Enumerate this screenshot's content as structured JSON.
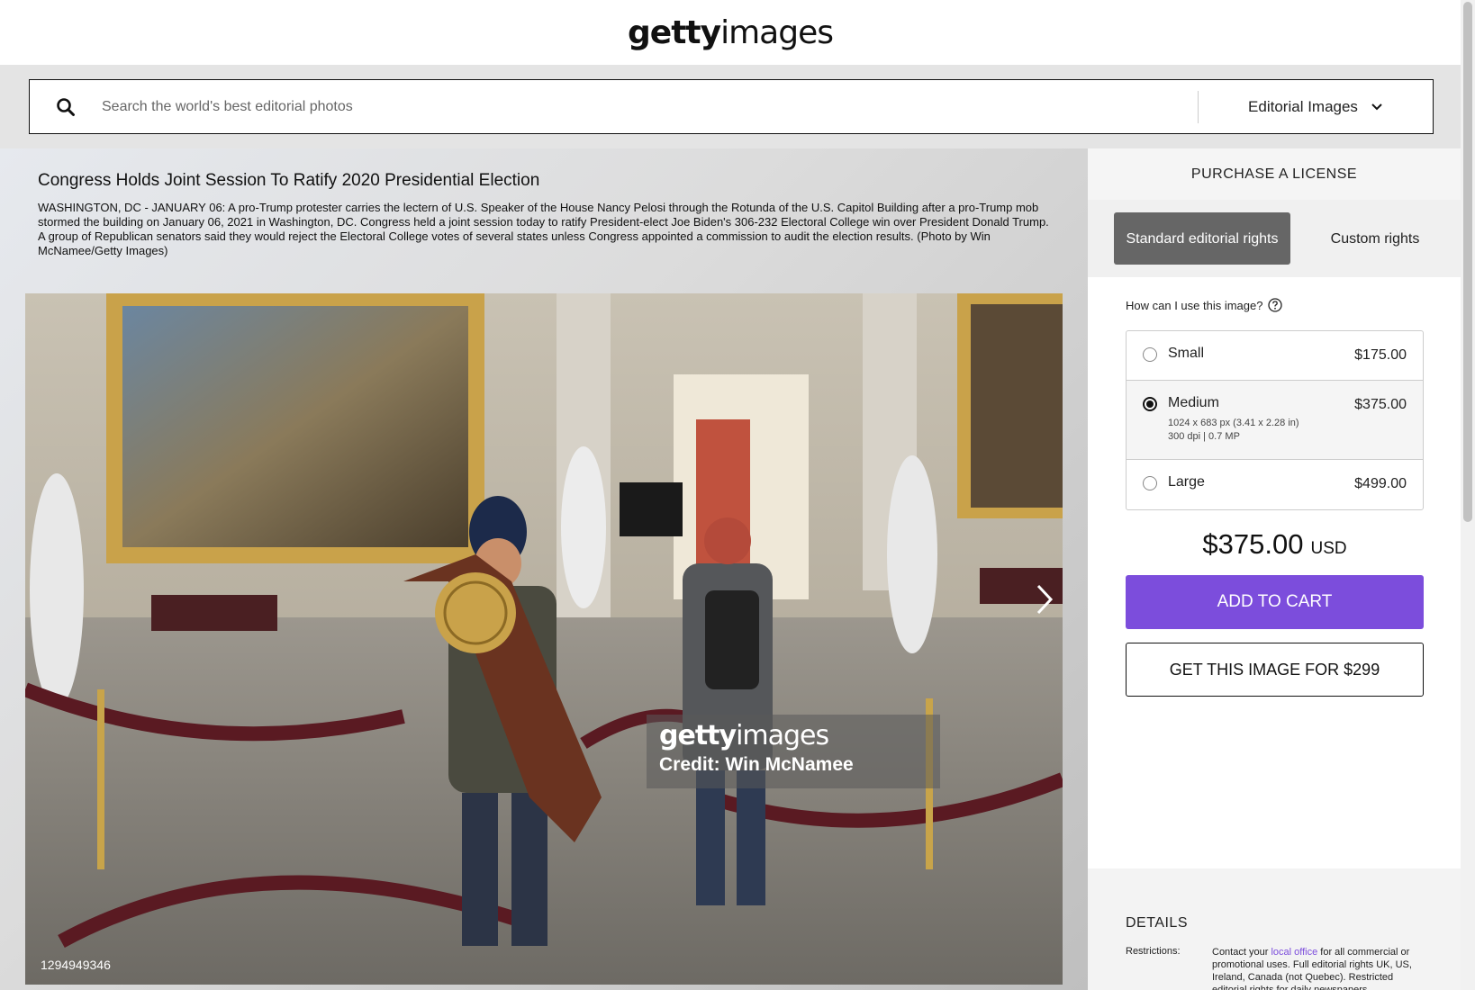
{
  "header": {
    "logo_bold": "getty",
    "logo_regular": "images"
  },
  "search": {
    "placeholder": "Search the world's best editorial photos",
    "category": "Editorial Images"
  },
  "image": {
    "title": "Congress Holds Joint Session To Ratify 2020 Presidential Election",
    "caption": "WASHINGTON, DC - JANUARY 06: A pro-Trump protester carries the lectern of U.S. Speaker of the House Nancy Pelosi through the Rotunda of the U.S. Capitol Building after a pro-Trump mob stormed the building on January 06, 2021 in Washington, DC. Congress held a joint session today to ratify President-elect Joe Biden's 306-232 Electoral College win over President Donald Trump. A group of Republican senators said they would reject the Electoral College votes of several states unless Congress appointed a commission to audit the election results. (Photo by Win McNamee/Getty Images)",
    "id": "1294949346",
    "watermark_logo_bold": "getty",
    "watermark_logo_regular": "images",
    "watermark_credit": "Credit: Win McNamee"
  },
  "purchase": {
    "heading": "PURCHASE A LICENSE",
    "tabs": [
      {
        "label": "Standard editorial rights",
        "active": true
      },
      {
        "label": "Custom rights",
        "active": false
      }
    ],
    "usage_question": "How can I use this image?",
    "sizes": [
      {
        "name": "Small",
        "price": "$175.00",
        "selected": false
      },
      {
        "name": "Medium",
        "price": "$375.00",
        "selected": true,
        "dimensions": "1024 x 683 px (3.41 x 2.28 in)",
        "resolution": "300 dpi | 0.7 MP"
      },
      {
        "name": "Large",
        "price": "$499.00",
        "selected": false
      }
    ],
    "total": "$375.00",
    "currency": "USD",
    "add_to_cart": "ADD TO CART",
    "get_image": "GET THIS IMAGE FOR $299",
    "accent_color": "#7c4ddc"
  },
  "details": {
    "heading": "DETAILS",
    "restrictions_label": "Restrictions:",
    "restrictions_prefix": "Contact your",
    "restrictions_link": "local office",
    "restrictions_suffix": "for all commercial or promotional uses. Full editorial rights UK, US, Ireland, Canada (not Quebec). Restricted editorial rights for daily newspapers"
  }
}
